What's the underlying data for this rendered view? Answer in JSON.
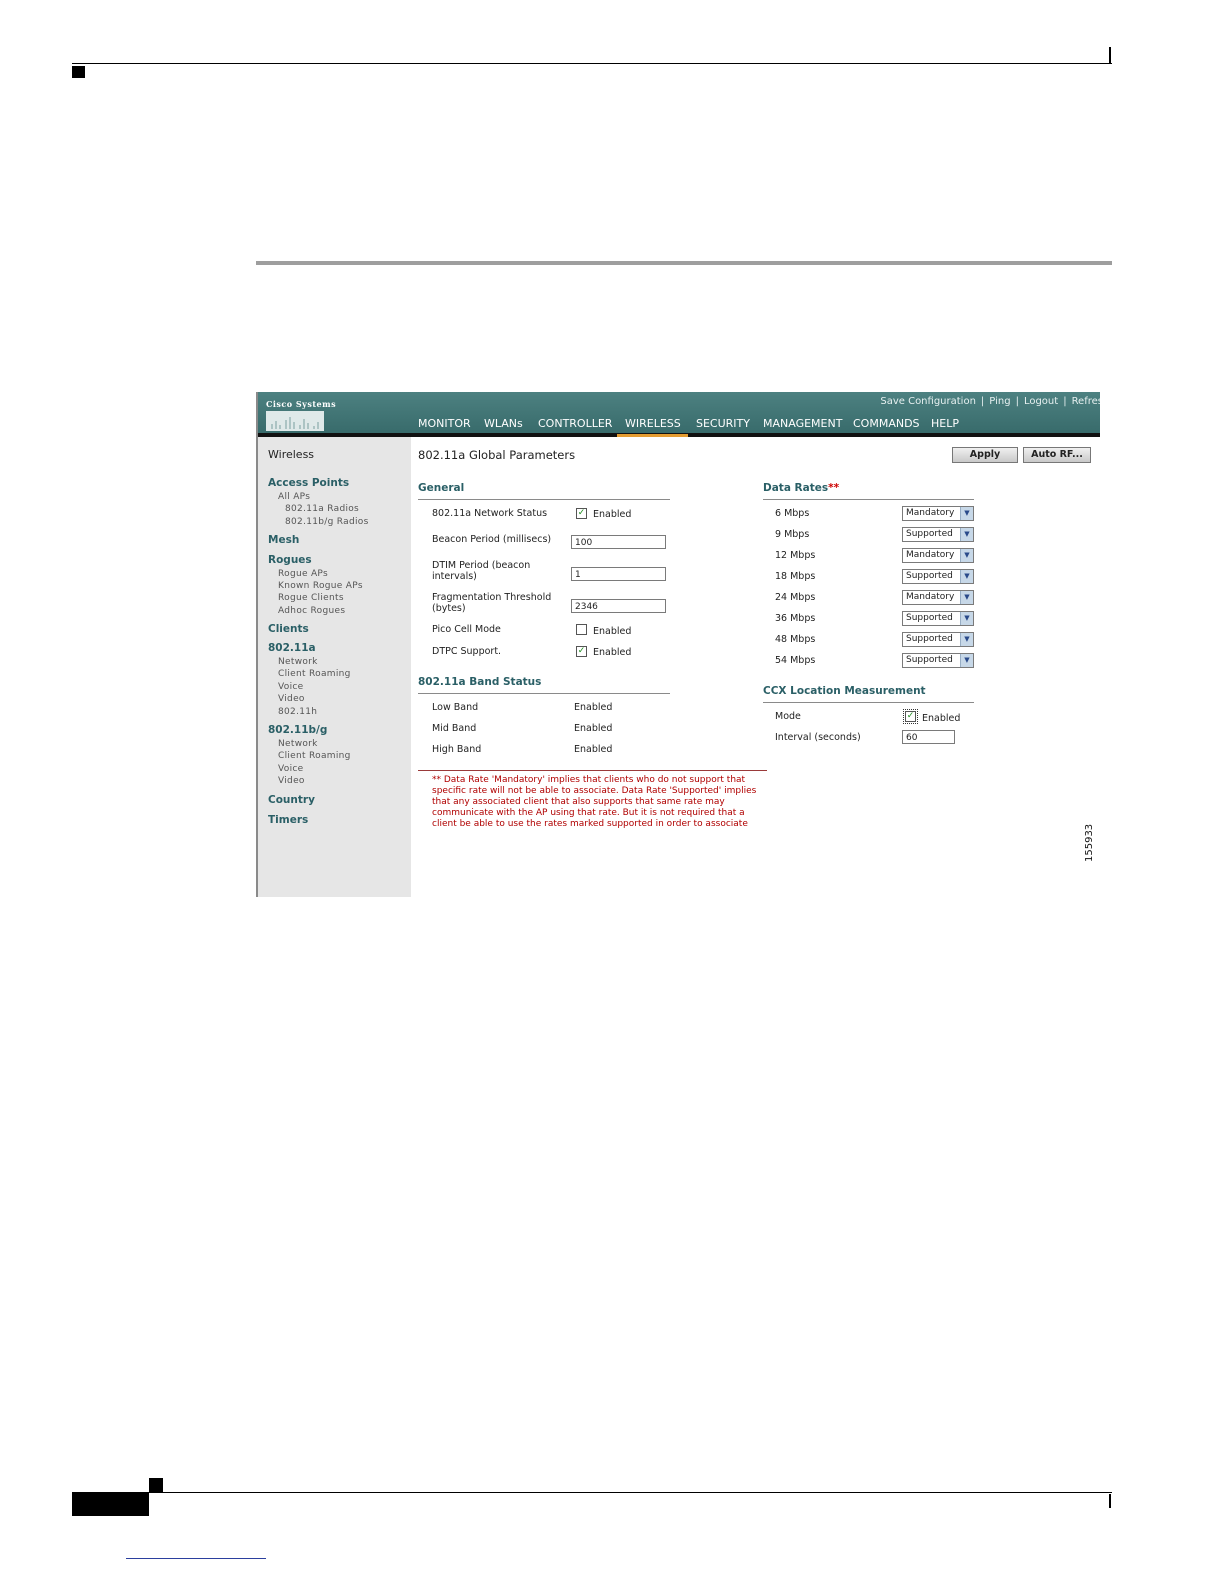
{
  "topbar": {
    "logo": "Cisco Systems",
    "links": [
      "Save Configuration",
      "Ping",
      "Logout",
      "Refres"
    ]
  },
  "nav": [
    "MONITOR",
    "WLANs",
    "CONTROLLER",
    "WIRELESS",
    "SECURITY",
    "MANAGEMENT",
    "COMMANDS",
    "HELP"
  ],
  "nav_active": "WIRELESS",
  "sidebar": {
    "title": "Wireless",
    "access_points": "Access Points",
    "all_aps": "All APs",
    "radio_a": "802.11a Radios",
    "radio_bg": "802.11b/g Radios",
    "mesh": "Mesh",
    "rogues": "Rogues",
    "rogue_aps": "Rogue APs",
    "known_rogue_aps": "Known Rogue APs",
    "rogue_clients": "Rogue Clients",
    "adhoc_rogues": "Adhoc Rogues",
    "clients": "Clients",
    "a": "802.11a",
    "a_network": "Network",
    "a_roaming": "Client Roaming",
    "a_voice": "Voice",
    "a_video": "Video",
    "a_h": "802.11h",
    "bg": "802.11b/g",
    "bg_network": "Network",
    "bg_roaming": "Client Roaming",
    "bg_voice": "Voice",
    "bg_video": "Video",
    "country": "Country",
    "timers": "Timers"
  },
  "page": {
    "title": "802.11a Global Parameters",
    "apply": "Apply",
    "auto_rf": "Auto RF..."
  },
  "general": {
    "heading": "General",
    "network_status_label": "802.11a Network Status",
    "network_status_value": "Enabled",
    "beacon_label": "Beacon Period (millisecs)",
    "beacon_value": "100",
    "dtim_label_1": "DTIM Period (beacon",
    "dtim_label_2": "intervals)",
    "dtim_value": "1",
    "frag_label_1": "Fragmentation Threshold",
    "frag_label_2": "(bytes)",
    "frag_value": "2346",
    "pico_label": "Pico Cell Mode",
    "pico_value": "Enabled",
    "dtpc_label": "DTPC Support.",
    "dtpc_value": "Enabled",
    "checked": {
      "network_status": true,
      "pico": false,
      "dtpc": true
    }
  },
  "band_status": {
    "heading": "802.11a Band Status",
    "low_label": "Low Band",
    "low_value": "Enabled",
    "mid_label": "Mid Band",
    "mid_value": "Enabled",
    "high_label": "High Band",
    "high_value": "Enabled"
  },
  "data_rates": {
    "heading": "Data Rates",
    "marker": "**",
    "rows": [
      {
        "rate": "6 Mbps",
        "value": "Mandatory"
      },
      {
        "rate": "9 Mbps",
        "value": "Supported"
      },
      {
        "rate": "12 Mbps",
        "value": "Mandatory"
      },
      {
        "rate": "18 Mbps",
        "value": "Supported"
      },
      {
        "rate": "24 Mbps",
        "value": "Mandatory"
      },
      {
        "rate": "36 Mbps",
        "value": "Supported"
      },
      {
        "rate": "48 Mbps",
        "value": "Supported"
      },
      {
        "rate": "54 Mbps",
        "value": "Supported"
      }
    ]
  },
  "ccx": {
    "heading": "CCX Location Measurement",
    "mode_label": "Mode",
    "mode_value": "Enabled",
    "mode_checked": true,
    "interval_label": "Interval (seconds)",
    "interval_value": "60"
  },
  "note": "** Data Rate 'Mandatory' implies that clients who do not support that specific rate will not be able to associate. Data Rate 'Supported' implies that any associated client that also supports that same rate may communicate with the AP using that rate. But it is not required that a client be able to use the rates marked supported in order to associate",
  "figure_id": "155933",
  "colors": {
    "topbar": "#3f7575",
    "accent": "#e49c31",
    "heading": "#2a5f66",
    "note": "#b00000",
    "sidebar": "#e6e6e6"
  }
}
